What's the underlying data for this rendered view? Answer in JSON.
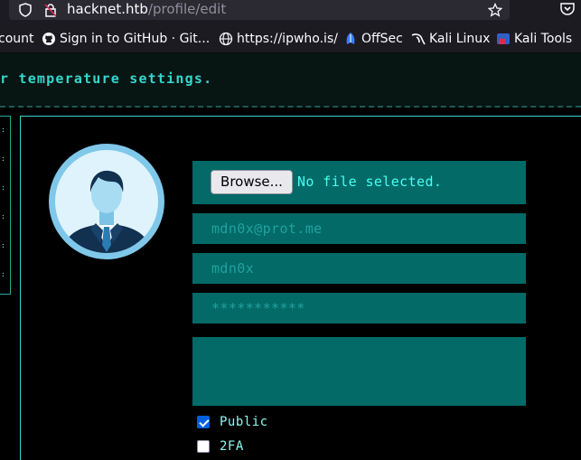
{
  "browser": {
    "url_host": "hacknet.htb",
    "url_path": "/profile/edit",
    "bookmarks": [
      {
        "label": "count",
        "icon": "bookmark-partial"
      },
      {
        "label": "Sign in to GitHub · Git...",
        "icon": "github-icon"
      },
      {
        "label": "https://ipwho.is/",
        "icon": "globe-icon"
      },
      {
        "label": "OffSec",
        "icon": "offsec-icon"
      },
      {
        "label": "Kali Linux",
        "icon": "kali-dragon-icon"
      },
      {
        "label": "Kali Tools",
        "icon": "kali-tools-icon"
      }
    ]
  },
  "banner": {
    "text": "r temperature settings."
  },
  "profile_form": {
    "browse_label": "Browse...",
    "file_status": "No file selected.",
    "email_placeholder": "mdn0x@prot.me",
    "username_placeholder": "mdn0x",
    "password_placeholder": "***********",
    "bio_value": "",
    "public_label": "Public",
    "public_checked": true,
    "twofa_label": "2FA",
    "twofa_checked": false
  },
  "colors": {
    "accent": "#36d6cc",
    "field_bg": "#036a67",
    "field_text": "#46fff2",
    "placeholder": "#1fa39d"
  }
}
